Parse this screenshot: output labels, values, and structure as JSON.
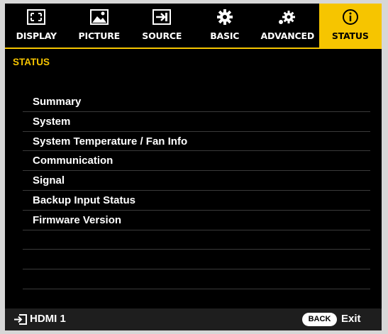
{
  "tabs": [
    {
      "label": "DISPLAY",
      "icon": "display-icon",
      "active": false
    },
    {
      "label": "PICTURE",
      "icon": "picture-icon",
      "active": false
    },
    {
      "label": "SOURCE",
      "icon": "source-icon",
      "active": false
    },
    {
      "label": "BASIC",
      "icon": "gear-icon",
      "active": false
    },
    {
      "label": "ADVANCED",
      "icon": "advanced-gear-icon",
      "active": false
    },
    {
      "label": "STATUS",
      "icon": "info-icon",
      "active": true
    }
  ],
  "section_title": "STATUS",
  "menu_items": [
    "Summary",
    "System",
    "System Temperature / Fan Info",
    "Communication",
    "Signal",
    "Backup Input Status",
    "Firmware Version"
  ],
  "footer": {
    "input_icon": "input-source-icon",
    "input_label": "HDMI 1",
    "back_button": "BACK",
    "exit_label": "Exit"
  },
  "colors": {
    "accent": "#f6c500",
    "background": "#000000",
    "text": "#ffffff"
  }
}
